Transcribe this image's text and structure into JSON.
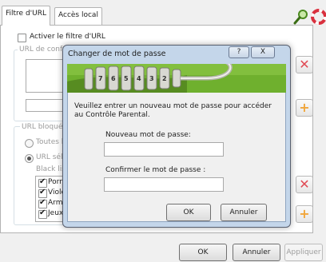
{
  "tabs": {
    "filter": "Filtre d'URL",
    "local": "Accès local"
  },
  "toolbar": {
    "search_icon": "search-icon",
    "lifebuoy_icon": "lifebuoy-icon"
  },
  "filter": {
    "enable_label": "Activer le filtre d'URL",
    "url_group_label": "URL de conf",
    "blocked_group_label": "URL bloquée",
    "radio_all": "Toutes l",
    "radio_selected": "URL séle",
    "blacklist_label": "Black lis",
    "categories": [
      "Porn",
      "Viole",
      "Arme",
      "Jeux"
    ]
  },
  "footer": {
    "ok": "OK",
    "cancel": "Annuler",
    "apply": "Appliquer"
  },
  "dialog": {
    "title": "Changer de mot de passe",
    "help": "?",
    "close": "X",
    "message": "Veuillez entrer un nouveau mot de passe pour accéder au Contrôle Parental.",
    "new_label": "Nouveau mot de passe:",
    "new_value": "",
    "confirm_label": "Confirmer le mot de passe :",
    "confirm_value": "",
    "ok": "OK",
    "cancel": "Annuler"
  },
  "colors": {
    "banner_green": "#6fb02e",
    "delete_red": "#e04b55",
    "add_orange": "#f1a63b"
  }
}
